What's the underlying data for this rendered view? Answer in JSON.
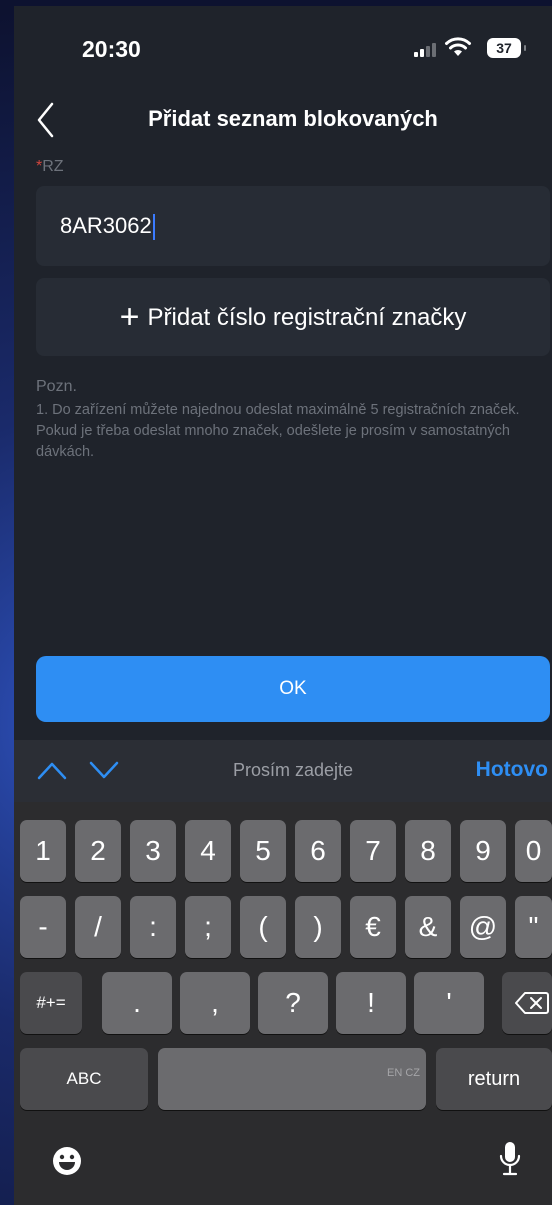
{
  "status": {
    "time": "20:30",
    "battery": "37"
  },
  "nav": {
    "title": "Přidat seznam blokovaných"
  },
  "form": {
    "required_mark": "*",
    "label": "RZ",
    "plate_value": "8AR3062",
    "add_button_plus": "+",
    "add_button": "Přidat číslo registrační značky"
  },
  "note": {
    "title": "Pozn.",
    "body": "1. Do zařízení můžete najednou odeslat maximálně 5 registračních značek. Pokud je třeba odeslat mnoho značek, odešlete je prosím v samostatných dávkách."
  },
  "ok_button": "OK",
  "keyboard_toolbar": {
    "hint": "Prosím zadejte",
    "done": "Hotovo"
  },
  "keyboard": {
    "row1": [
      "1",
      "2",
      "3",
      "4",
      "5",
      "6",
      "7",
      "8",
      "9",
      "0"
    ],
    "row2": [
      "-",
      "/",
      ":",
      ";",
      "(",
      ")",
      "€",
      "&",
      "@",
      "\""
    ],
    "row3_left": "#+=",
    "row3": [
      ".",
      ",",
      "?",
      "!",
      "'"
    ],
    "abc": "ABC",
    "space_lang": "EN CZ",
    "return": "return"
  },
  "icons": {
    "back": "chevron-left-icon",
    "backspace": "backspace-icon",
    "emoji": "emoji-icon",
    "mic": "microphone-icon"
  },
  "colors": {
    "accent": "#2e8ef3",
    "required": "#d0463e",
    "background": "#1f232b",
    "card": "#272c35"
  }
}
